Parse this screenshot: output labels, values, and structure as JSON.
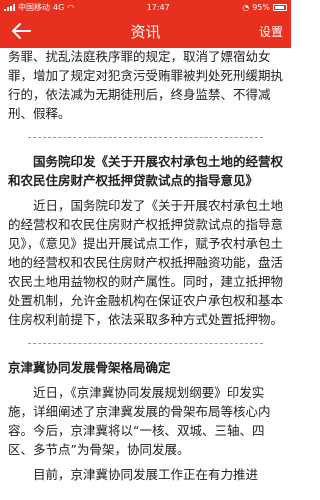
{
  "status_bar": {
    "carrier": "中国移动",
    "network": "4G",
    "time": "17:47",
    "battery": "95%"
  },
  "app_bar": {
    "title": "资讯",
    "settings_label": "设置",
    "back_icon": "back-arrow-icon"
  },
  "article": {
    "intro_paragraph": "务罪、扰乱法庭秩序罪的规定，取消了嫖宿幼女罪，增加了规定对犯贪污受贿罪被判处死刑缓期执行的，依法减为无期徒刑后，终身监禁、不得减刑、假释。",
    "sections": [
      {
        "headline": "国务院印发《关于开展农村承包土地的经营权和农民住房财产权抵押贷款试点的指导意见》",
        "body": "近日，国务院印发了《关于开展农村承包土地的经营权和农民住房财产权抵押贷款试点的指导意见》，《意见》提出开展试点工作，赋予农村承包土地的经营权和农民住房财产权抵押融资功能，盘活农民土地用益物权的财产属性。同时，建立抵押物处置机制，允许金融机构在保证农户承包权和基本住房权利前提下，依法采取多种方式处置抵押物。"
      },
      {
        "headline": "京津冀协同发展骨架格局确定",
        "body": "近日，《京津冀协同发展规划纲要》印发实施，详细阐述了京津冀发展的骨架布局等核心内容。今后，京津冀将以“一核、双城、三轴、四区、多节点”为骨架，协同发展。"
      }
    ],
    "cut_off_line": "目前，京津冀协同发展工作正在有力推进"
  }
}
